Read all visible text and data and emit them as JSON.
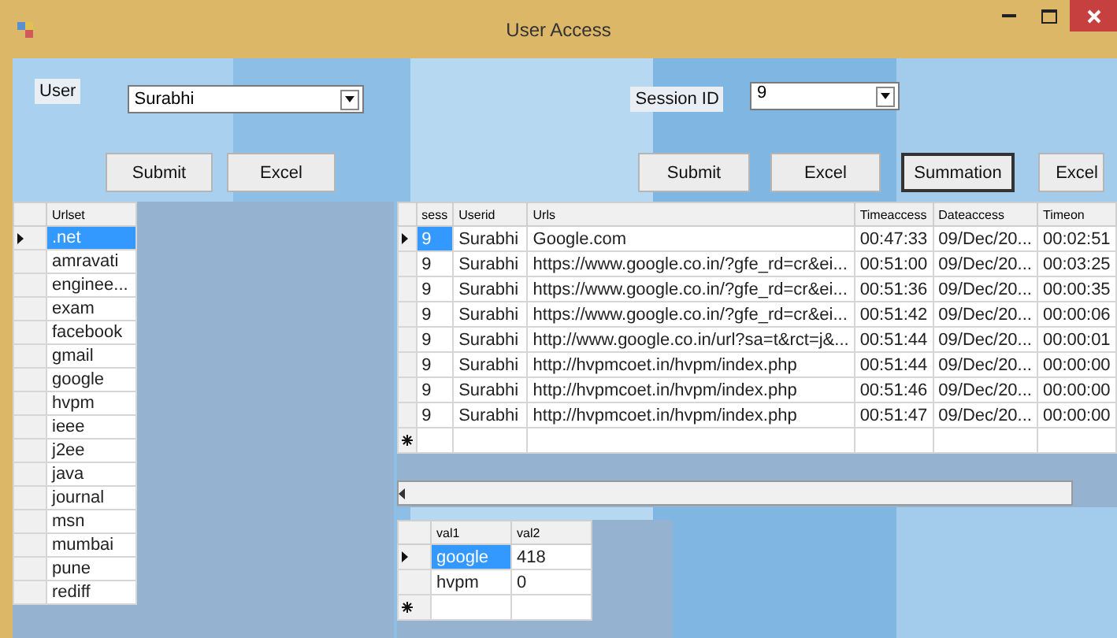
{
  "window": {
    "title": "User Access"
  },
  "user_filter": {
    "label": "User",
    "value": "Surabhi",
    "buttons": [
      {
        "label": "Submit",
        "focused": false
      },
      {
        "label": "Excel",
        "focused": false
      }
    ]
  },
  "session_filter": {
    "label": "Session ID",
    "value": "9",
    "buttons": [
      {
        "label": "Submit",
        "focused": false
      },
      {
        "label": "Excel",
        "focused": false
      },
      {
        "label": "Summation",
        "focused": true
      },
      {
        "label": "Excel",
        "focused": false
      }
    ]
  },
  "urlset_grid": {
    "columns": [
      "Urlset"
    ],
    "rows": [
      {
        "cells": [
          ".net"
        ],
        "selected": true
      },
      {
        "cells": [
          "amravati"
        ],
        "selected": false
      },
      {
        "cells": [
          "enginee..."
        ],
        "selected": false
      },
      {
        "cells": [
          "exam"
        ],
        "selected": false
      },
      {
        "cells": [
          "facebook"
        ],
        "selected": false
      },
      {
        "cells": [
          "gmail"
        ],
        "selected": false
      },
      {
        "cells": [
          "google"
        ],
        "selected": false
      },
      {
        "cells": [
          "hvpm"
        ],
        "selected": false
      },
      {
        "cells": [
          "ieee"
        ],
        "selected": false
      },
      {
        "cells": [
          "j2ee"
        ],
        "selected": false
      },
      {
        "cells": [
          "java"
        ],
        "selected": false
      },
      {
        "cells": [
          "journal"
        ],
        "selected": false
      },
      {
        "cells": [
          "msn"
        ],
        "selected": false
      },
      {
        "cells": [
          "mumbai"
        ],
        "selected": false
      },
      {
        "cells": [
          "pune"
        ],
        "selected": false
      },
      {
        "cells": [
          "rediff"
        ],
        "selected": false
      }
    ]
  },
  "access_grid": {
    "columns": [
      "sess",
      "Userid",
      "Urls",
      "Timeaccess",
      "Dateaccess",
      "Timeon"
    ],
    "rows": [
      {
        "cells": [
          "9",
          "Surabhi",
          "Google.com",
          "00:47:33",
          "09/Dec/20...",
          "00:02:51"
        ],
        "selected": true
      },
      {
        "cells": [
          "9",
          "Surabhi",
          "https://www.google.co.in/?gfe_rd=cr&ei...",
          "00:51:00",
          "09/Dec/20...",
          "00:03:25"
        ],
        "selected": false
      },
      {
        "cells": [
          "9",
          "Surabhi",
          "https://www.google.co.in/?gfe_rd=cr&ei...",
          "00:51:36",
          "09/Dec/20...",
          "00:00:35"
        ],
        "selected": false
      },
      {
        "cells": [
          "9",
          "Surabhi",
          "https://www.google.co.in/?gfe_rd=cr&ei...",
          "00:51:42",
          "09/Dec/20...",
          "00:00:06"
        ],
        "selected": false
      },
      {
        "cells": [
          "9",
          "Surabhi",
          "http://www.google.co.in/url?sa=t&rct=j&...",
          "00:51:44",
          "09/Dec/20...",
          "00:00:01"
        ],
        "selected": false
      },
      {
        "cells": [
          "9",
          "Surabhi",
          "http://hvpmcoet.in/hvpm/index.php",
          "00:51:44",
          "09/Dec/20...",
          "00:00:00"
        ],
        "selected": false
      },
      {
        "cells": [
          "9",
          "Surabhi",
          "http://hvpmcoet.in/hvpm/index.php",
          "00:51:46",
          "09/Dec/20...",
          "00:00:00"
        ],
        "selected": false
      },
      {
        "cells": [
          "9",
          "Surabhi",
          "http://hvpmcoet.in/hvpm/index.php",
          "00:51:47",
          "09/Dec/20...",
          "00:00:00"
        ],
        "selected": false
      }
    ],
    "new_row": true
  },
  "summary_grid": {
    "columns": [
      "val1",
      "val2"
    ],
    "rows": [
      {
        "cells": [
          "google",
          "418"
        ],
        "selected": true
      },
      {
        "cells": [
          "hvpm",
          "0"
        ],
        "selected": false
      }
    ],
    "new_row": true
  }
}
